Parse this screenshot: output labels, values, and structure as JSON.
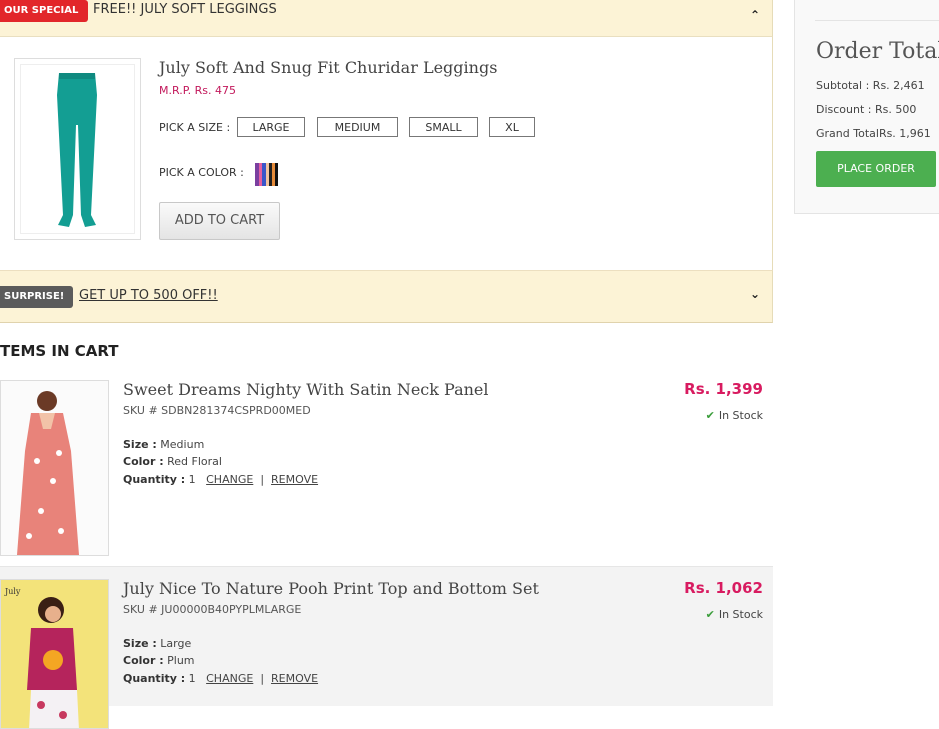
{
  "special": {
    "tag": "OUR SPECIAL",
    "text": "FREE!! JULY SOFT LEGGINGS",
    "product": {
      "title": "July Soft And Snug Fit Churidar Leggings",
      "mrp": "M.R.P. Rs. 475",
      "size_label": "PICK A SIZE :",
      "sizes": [
        "LARGE",
        "MEDIUM",
        "SMALL",
        "XL"
      ],
      "color_label": "PICK A COLOR :",
      "add_to_cart": "ADD TO CART"
    }
  },
  "surprise": {
    "tag": "SURPRISE!",
    "link": "GET UP TO 500 OFF!!"
  },
  "items_heading": "TEMS IN CART",
  "cart_items": [
    {
      "title": "Sweet Dreams Nighty With Satin Neck Panel",
      "sku": "SKU # SDBN281374CSPRD00MED",
      "size_label": "Size :",
      "size": "Medium",
      "color_label": "Color :",
      "color": "Red Floral",
      "qty_label": "Quantity :",
      "qty": "1",
      "change": "CHANGE",
      "separator": "|",
      "remove": "REMOVE",
      "price": "Rs. 1,399",
      "stock": "In Stock"
    },
    {
      "title": "July Nice To Nature Pooh Print Top and Bottom Set",
      "sku": "SKU # JU00000B40PYPLMLARGE",
      "size_label": "Size :",
      "size": "Large",
      "color_label": "Color :",
      "color": "Plum",
      "qty_label": "Quantity :",
      "qty": "1",
      "change": "CHANGE",
      "separator": "|",
      "remove": "REMOVE",
      "price": "Rs. 1,062",
      "stock": "In Stock"
    }
  ],
  "order": {
    "title": "Order Total",
    "subtotal_label": "Subtotal :",
    "subtotal": "Rs. 2,461",
    "discount_label": "Discount :",
    "discount": "Rs. 500",
    "grand_label": "Grand Total",
    "grand": "Rs. 1,961",
    "place_order": "PLACE ORDER"
  },
  "colors": {
    "accent_red": "#e2262a",
    "price_pink": "#d81b60",
    "place_order_green": "#4caf50",
    "banner_bg": "#fcf3d6"
  }
}
